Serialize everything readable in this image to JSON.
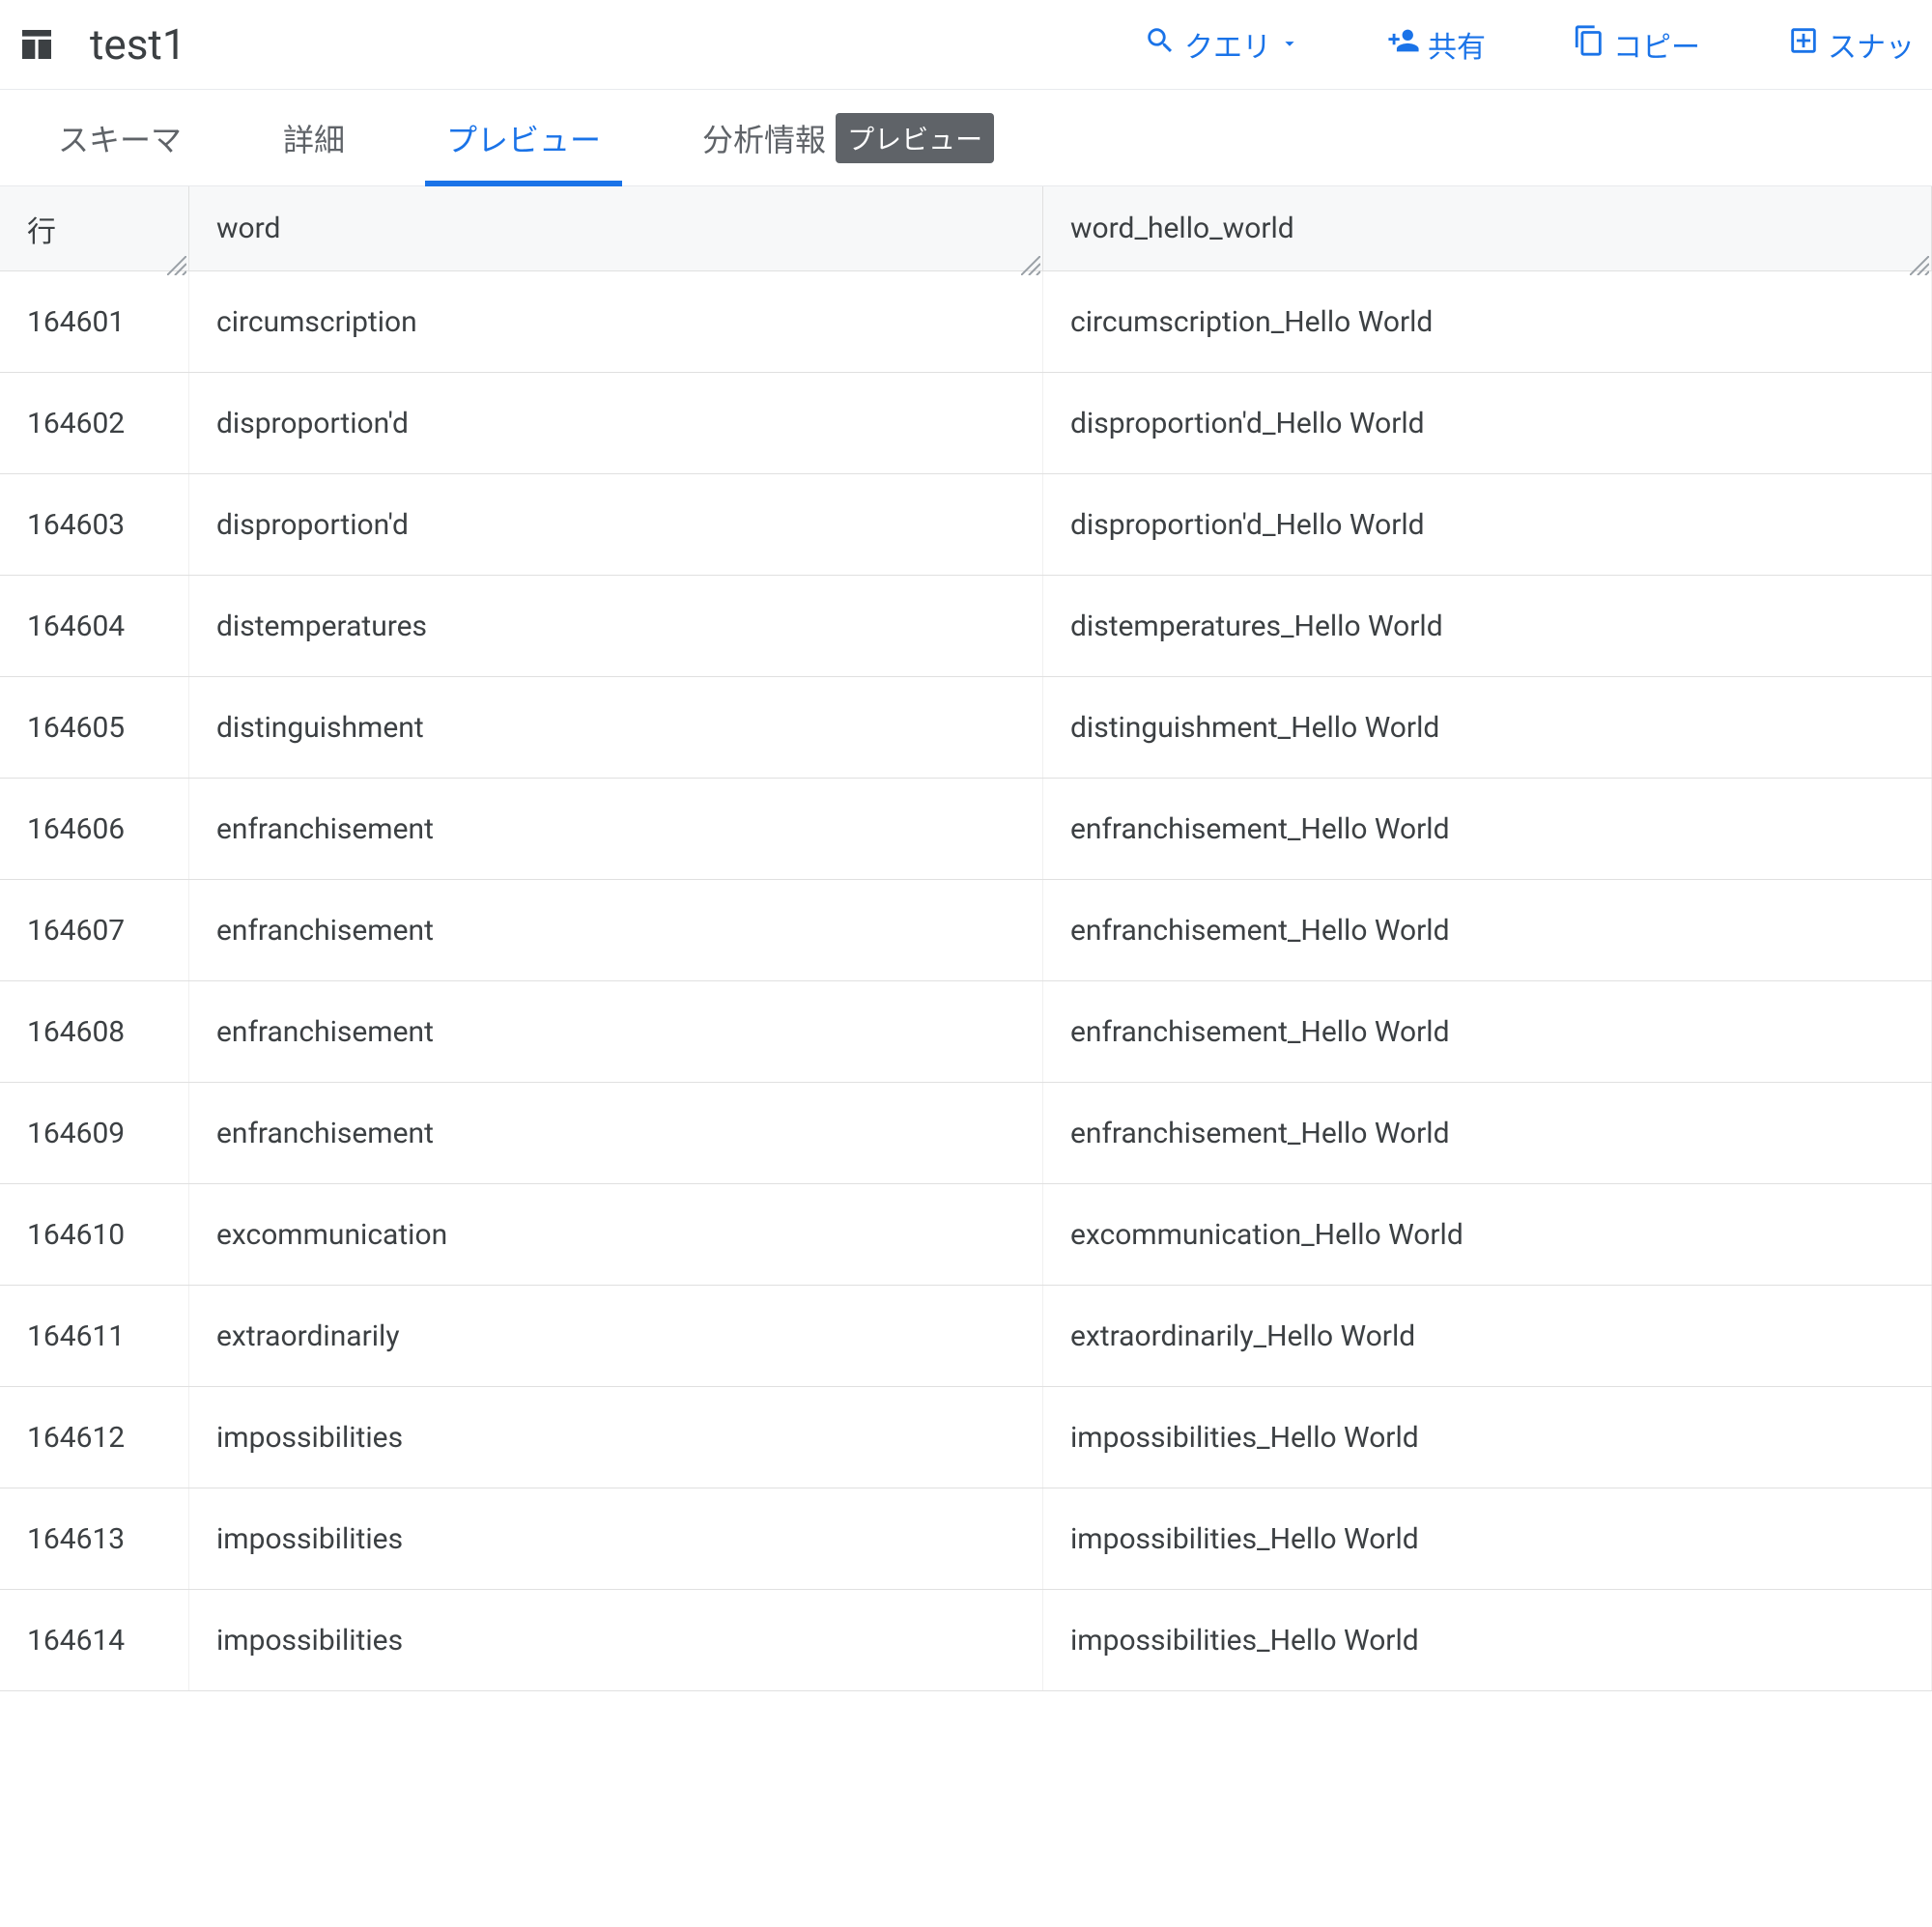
{
  "header": {
    "title": "test1",
    "toolbar": {
      "query": "クエリ",
      "share": "共有",
      "copy": "コピー",
      "snapshot": "スナッ"
    }
  },
  "tabs": {
    "items": [
      {
        "label": "スキーマ",
        "active": false
      },
      {
        "label": "詳細",
        "active": false
      },
      {
        "label": "プレビュー",
        "active": true
      },
      {
        "label": "分析情報",
        "active": false
      }
    ],
    "badge": "プレビュー"
  },
  "table": {
    "columns": {
      "row_label": "行",
      "word": "word",
      "word_hello_world": "word_hello_world"
    },
    "rows": [
      {
        "n": "164601",
        "word": "circumscription",
        "hello": "circumscription_Hello World"
      },
      {
        "n": "164602",
        "word": "disproportion'd",
        "hello": "disproportion'd_Hello World"
      },
      {
        "n": "164603",
        "word": "disproportion'd",
        "hello": "disproportion'd_Hello World"
      },
      {
        "n": "164604",
        "word": "distemperatures",
        "hello": "distemperatures_Hello World"
      },
      {
        "n": "164605",
        "word": "distinguishment",
        "hello": "distinguishment_Hello World"
      },
      {
        "n": "164606",
        "word": "enfranchisement",
        "hello": "enfranchisement_Hello World"
      },
      {
        "n": "164607",
        "word": "enfranchisement",
        "hello": "enfranchisement_Hello World"
      },
      {
        "n": "164608",
        "word": "enfranchisement",
        "hello": "enfranchisement_Hello World"
      },
      {
        "n": "164609",
        "word": "enfranchisement",
        "hello": "enfranchisement_Hello World"
      },
      {
        "n": "164610",
        "word": "excommunication",
        "hello": "excommunication_Hello World"
      },
      {
        "n": "164611",
        "word": "extraordinarily",
        "hello": "extraordinarily_Hello World"
      },
      {
        "n": "164612",
        "word": "impossibilities",
        "hello": "impossibilities_Hello World"
      },
      {
        "n": "164613",
        "word": "impossibilities",
        "hello": "impossibilities_Hello World"
      },
      {
        "n": "164614",
        "word": "impossibilities",
        "hello": "impossibilities_Hello World"
      }
    ]
  }
}
